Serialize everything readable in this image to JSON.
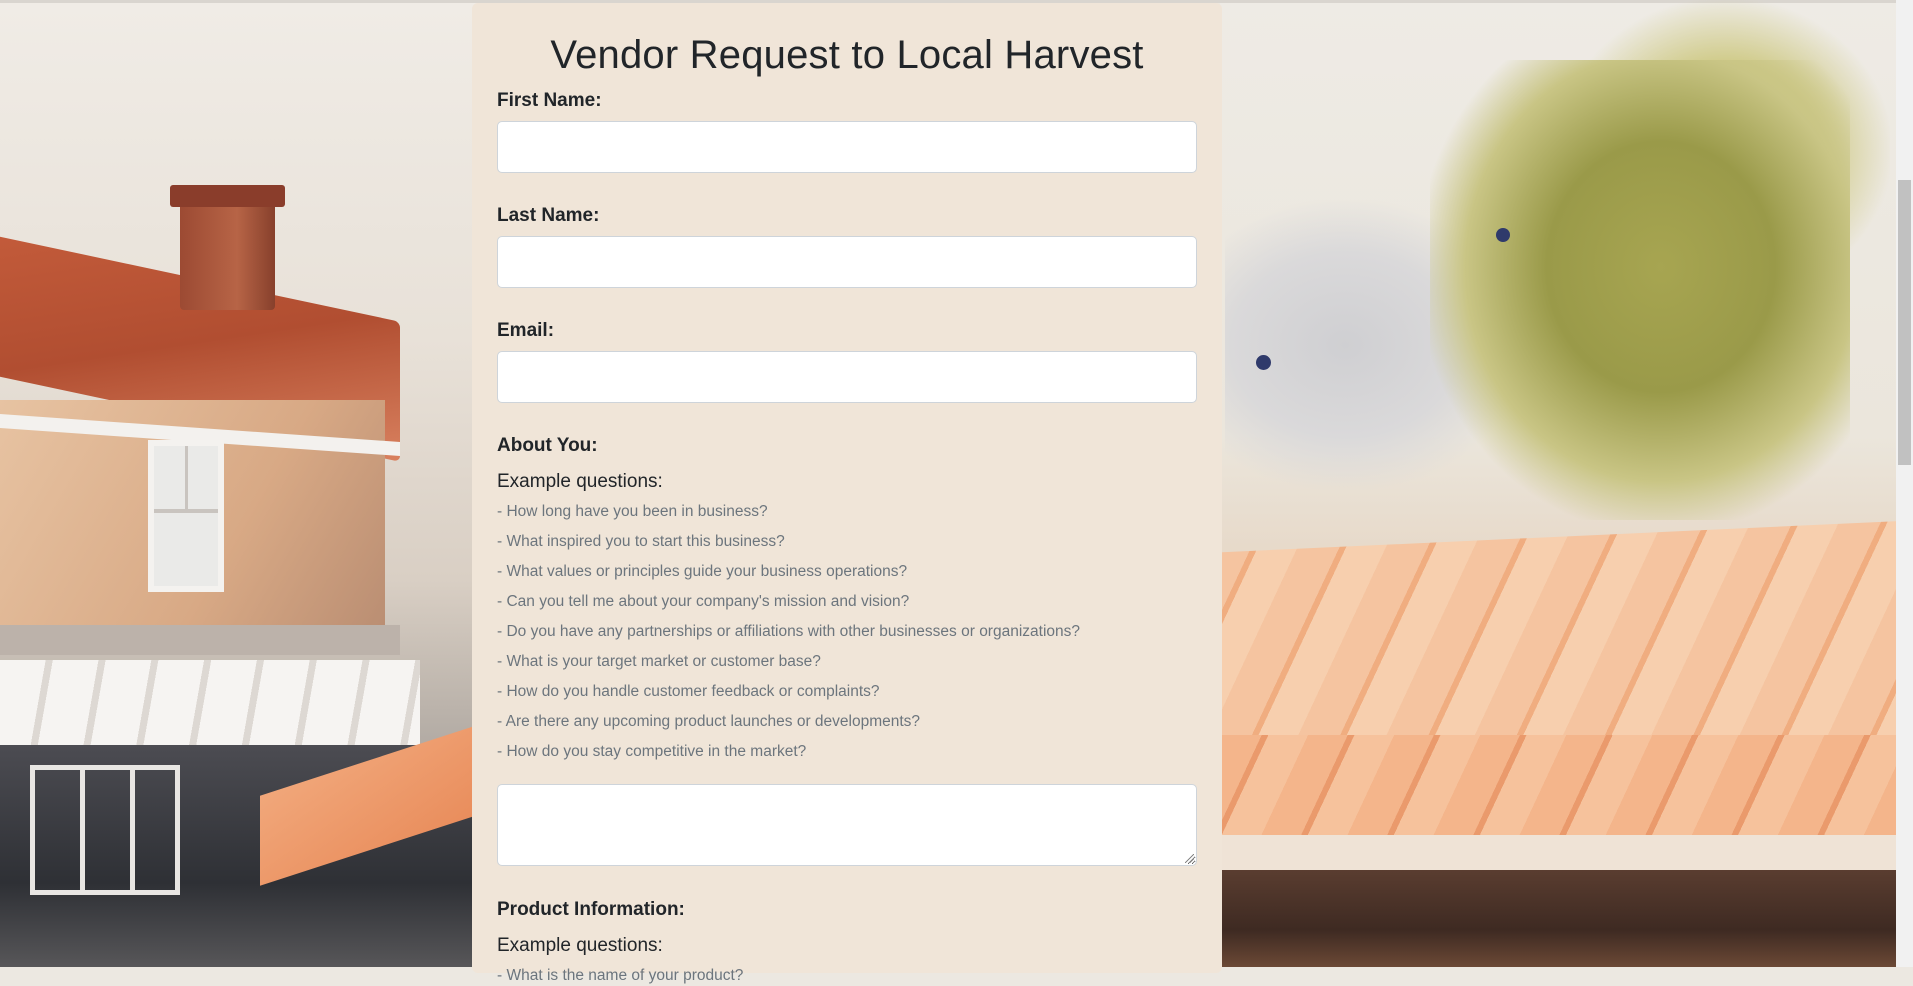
{
  "form": {
    "title": "Vendor Request to Local Harvest",
    "first_name_label": "First Name:",
    "last_name_label": "Last Name:",
    "email_label": "Email:",
    "first_name_value": "",
    "last_name_value": "",
    "email_value": ""
  },
  "about": {
    "label": "About You:",
    "example_heading": "Example questions:",
    "questions": [
      "- How long have you been in business?",
      "- What inspired you to start this business?",
      "- What values or principles guide your business operations?",
      "- Can you tell me about your company's mission and vision?",
      "- Do you have any partnerships or affiliations with other businesses or organizations?",
      "- What is your target market or customer base?",
      "- How do you handle customer feedback or complaints?",
      "- Are there any upcoming product launches or developments?",
      "- How do you stay competitive in the market?"
    ],
    "answer_value": ""
  },
  "product": {
    "label": "Product Information:",
    "example_heading": "Example questions:",
    "questions": [
      "- What is the name of your product?"
    ]
  },
  "colors": {
    "card_background": "#f0e5d8",
    "text": "#212529",
    "muted_text": "#6c757d"
  }
}
